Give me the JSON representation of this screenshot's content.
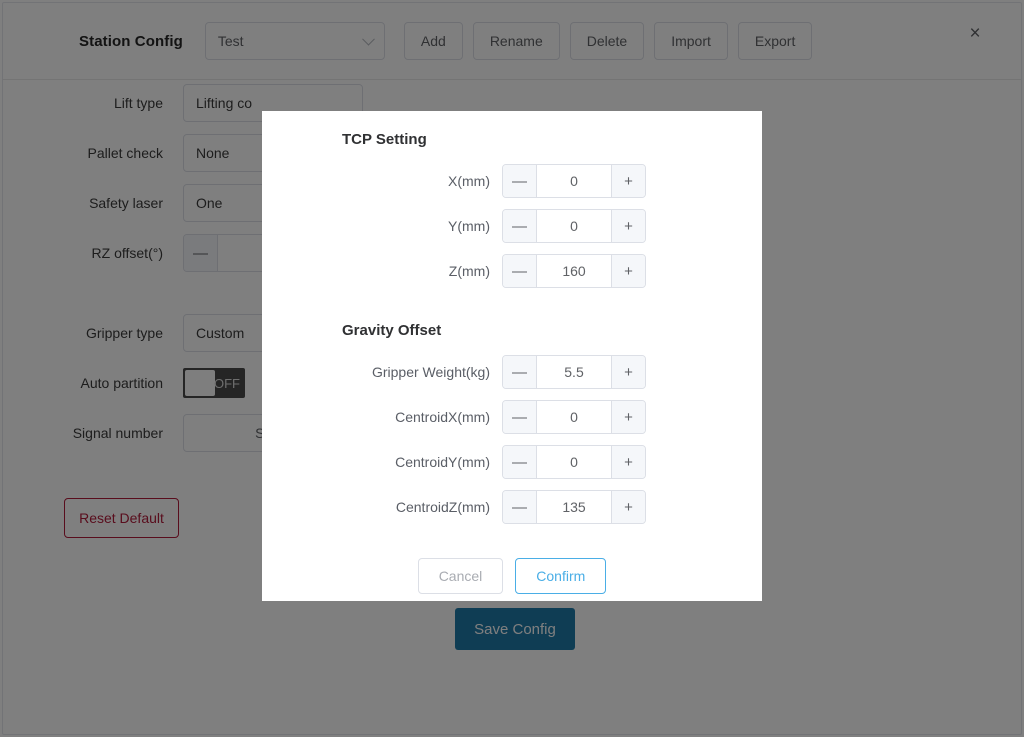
{
  "header": {
    "title": "Station Config",
    "select_value": "Test",
    "select_caret": "chevron-down-icon",
    "buttons": [
      {
        "label": "Add"
      },
      {
        "label": "Rename"
      },
      {
        "label": "Delete"
      },
      {
        "label": "Import"
      },
      {
        "label": "Export"
      }
    ],
    "close_label": "×"
  },
  "background_form": {
    "rows": [
      {
        "label": "Lift type",
        "value": "Lifting co",
        "type": "select"
      },
      {
        "label": "Pallet check",
        "value": "None",
        "type": "select"
      },
      {
        "label": "Safety laser",
        "value": "One",
        "type": "select"
      },
      {
        "label": "RZ offset(°)",
        "value": "",
        "type": "stepper",
        "minus": "—",
        "plus": "+"
      },
      {
        "label": "Gripper type",
        "value": "Custom",
        "type": "select"
      },
      {
        "label": "Auto partition",
        "value": "OFF",
        "type": "switch"
      },
      {
        "label": "Signal number",
        "value": "Settin",
        "type": "button"
      }
    ],
    "reset_button": "Reset Default",
    "save_button": "Save Config"
  },
  "modal": {
    "sections": [
      {
        "title": "TCP Setting",
        "fields": [
          {
            "label": "X(mm)",
            "value": "0"
          },
          {
            "label": "Y(mm)",
            "value": "0"
          },
          {
            "label": "Z(mm)",
            "value": "160"
          }
        ]
      },
      {
        "title": "Gravity Offset",
        "fields": [
          {
            "label": "Gripper Weight(kg)",
            "value": "5.5"
          },
          {
            "label": "CentroidX(mm)",
            "value": "0"
          },
          {
            "label": "CentroidY(mm)",
            "value": "0"
          },
          {
            "label": "CentroidZ(mm)",
            "value": "135"
          }
        ]
      }
    ],
    "stepper_minus": "—",
    "stepper_plus": "+",
    "cancel_label": "Cancel",
    "confirm_label": "Confirm"
  },
  "colors": {
    "overlay": "#808080",
    "confirm_accent": "#4aaee6",
    "reset_accent": "#b31b3a",
    "save_accent": "#1f7aa8"
  }
}
